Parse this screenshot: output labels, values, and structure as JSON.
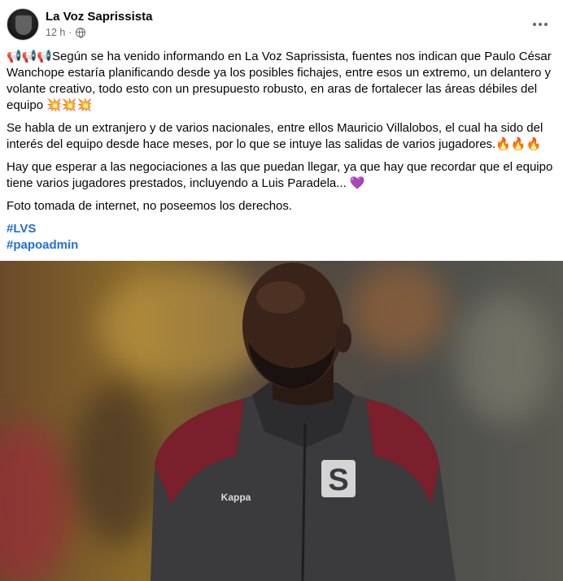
{
  "post": {
    "page_name": "La Voz Saprissista",
    "timestamp": "12 h",
    "separator": "·",
    "paragraphs": [
      "📢📢📢Según se ha venido informando en La Voz Saprissista, fuentes nos indican que Paulo César Wanchope estaría planificando desde ya los posibles fichajes, entre esos un extremo, un delantero y volante creativo, todo esto con un presupuesto robusto, en aras de fortalecer las áreas débiles del equipo 💥💥💥",
      "Se habla de un extranjero y de varios nacionales, entre ellos Mauricio Villalobos, el cual ha sido del interés del equipo desde hace meses, por lo que se intuye las salidas de varios jugadores.🔥🔥🔥",
      "Hay que esperar a las negociaciones a las que puedan llegar, ya que hay que recordar que el equipo tiene varios jugadores prestados, incluyendo a Luis Paradela... 💜",
      "Foto tomada de internet, no poseemos los derechos."
    ],
    "hashtags": [
      "#LVS",
      "#papoadmin"
    ]
  },
  "photo": {
    "jacket_logo_letter": "S",
    "jacket_brand": "Kappa"
  },
  "colors": {
    "link": "#216fdb",
    "secondary_text": "#65676b",
    "jacket_maroon": "#7a1f2c",
    "jacket_grey": "#3b3a3d"
  }
}
